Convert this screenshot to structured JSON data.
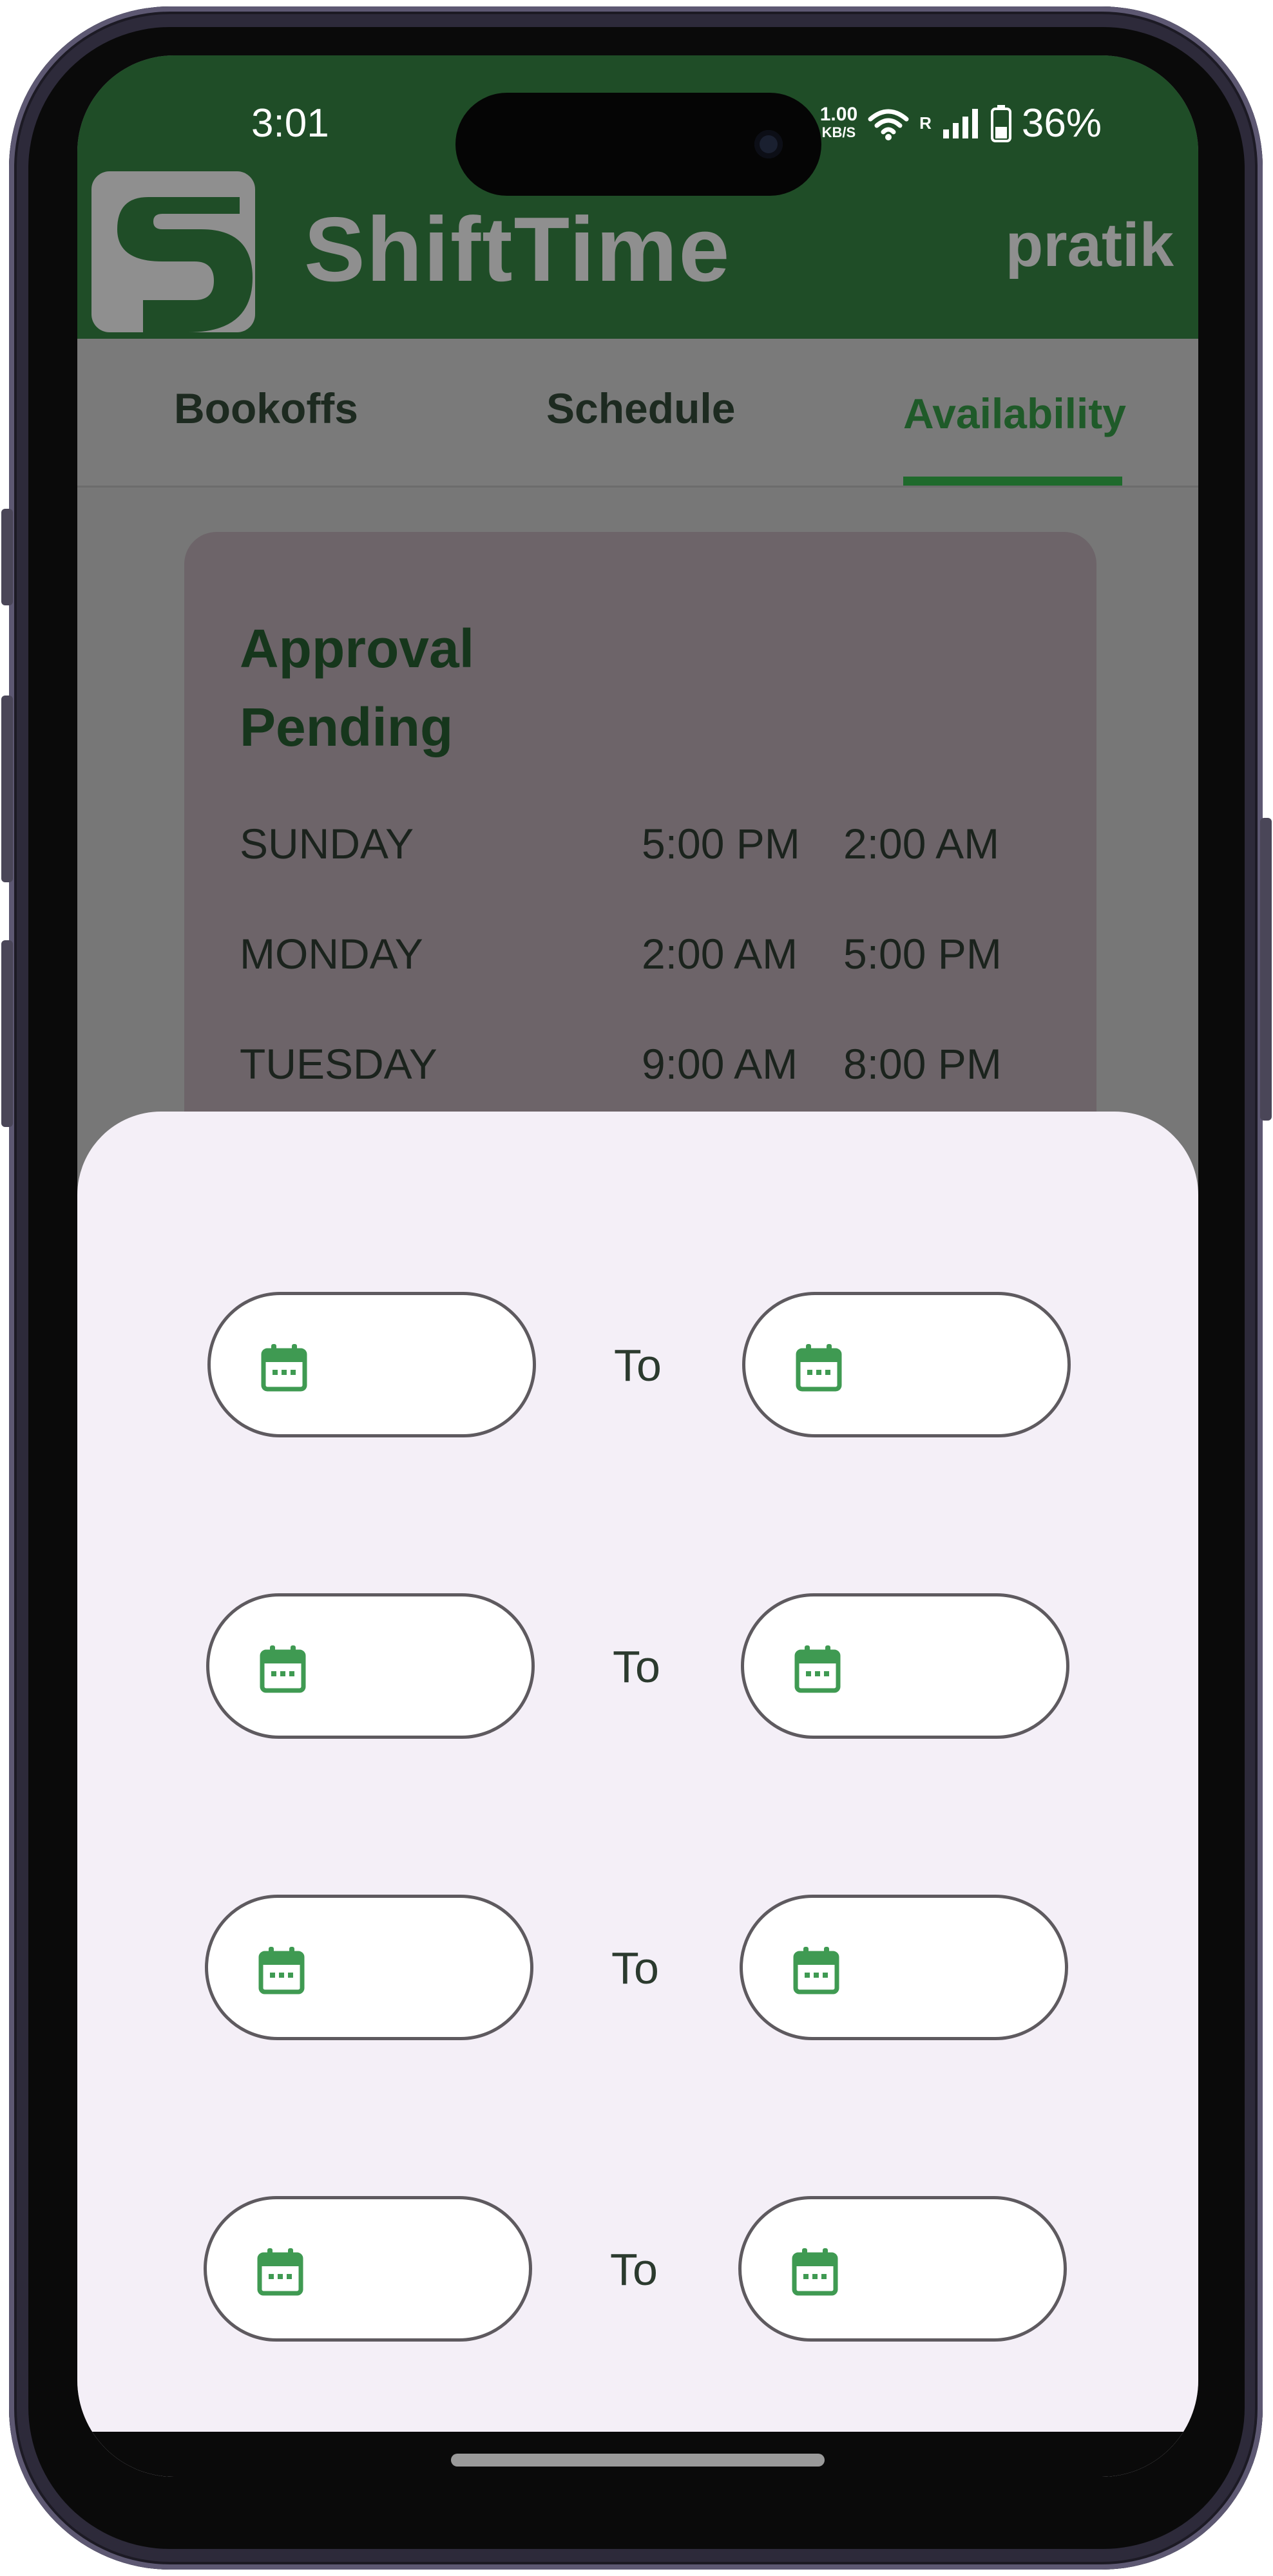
{
  "status_bar": {
    "time": "3:01",
    "net_speed_top": "1.00",
    "net_speed_bottom": "KB/S",
    "roaming": "R",
    "battery": "36%",
    "icons": [
      "wifi-icon",
      "signal-icon",
      "battery-icon"
    ]
  },
  "header": {
    "brand": "ShiftTime",
    "user": "pratik",
    "logo_icon": "shifttime-logo",
    "bg_color": "#1f4d27"
  },
  "tabs": [
    {
      "label": "Bookoffs",
      "active": false
    },
    {
      "label": "Schedule",
      "active": false
    },
    {
      "label": "Availability",
      "active": true
    }
  ],
  "card": {
    "title": "Approval Pending",
    "rows": [
      {
        "day": "SUNDAY",
        "from": "5:00 PM",
        "to": "2:00 AM"
      },
      {
        "day": "MONDAY",
        "from": "2:00 AM",
        "to": "5:00 PM"
      },
      {
        "day": "TUESDAY",
        "from": "9:00 AM",
        "to": "8:00 PM"
      }
    ]
  },
  "sheet": {
    "to_label": "To",
    "date_rows": [
      {
        "from_value": "",
        "to_value": ""
      },
      {
        "from_value": "",
        "to_value": ""
      },
      {
        "from_value": "",
        "to_value": ""
      },
      {
        "from_value": "",
        "to_value": ""
      }
    ],
    "field_icon": "calendar-icon",
    "accent": "#3f9a52"
  }
}
